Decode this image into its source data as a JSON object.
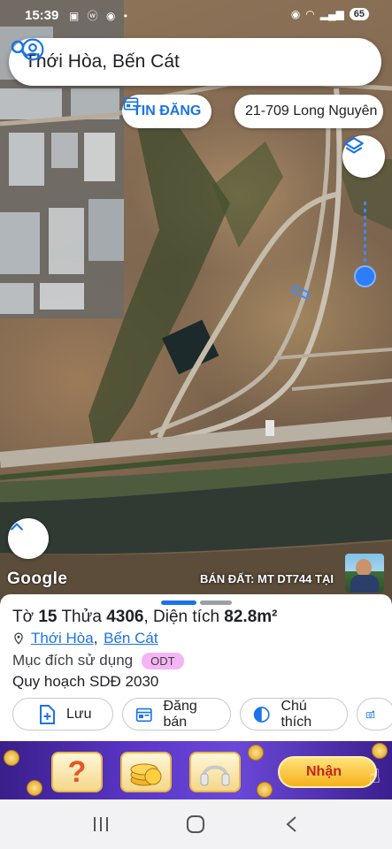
{
  "status_bar": {
    "time": "15:39",
    "battery": "65"
  },
  "search": {
    "query": "Thới Hòa, Bến Cát"
  },
  "chips": {
    "post_label": "TIN ĐĂNG",
    "address_label": "21-709 Long Nguyên"
  },
  "map": {
    "attribution": "Google",
    "ad_text": "BÁN ĐẤT: MT DT744 TẠI"
  },
  "parcel": {
    "prefix_sheet": "Tờ",
    "sheet_no": "15",
    "prefix_plot": "Thửa",
    "plot_no": "4306",
    "area_label": ", Diện tích",
    "area_value": "82.8m²",
    "ward": "Thới Hòa",
    "district": "Bến Cát",
    "purpose_label": "Mục đích sử dụng",
    "purpose_code": "ODT",
    "plan_label": "Quy hoạch SDĐ 2030"
  },
  "actions": {
    "save": "Lưu",
    "post": "Đăng bán",
    "legend": "Chú thích"
  },
  "banner": {
    "claim_label": "Nhận"
  },
  "colors": {
    "accent": "#1a73e8",
    "badge": "#f5b5f5",
    "slider": "#2d7df6"
  }
}
